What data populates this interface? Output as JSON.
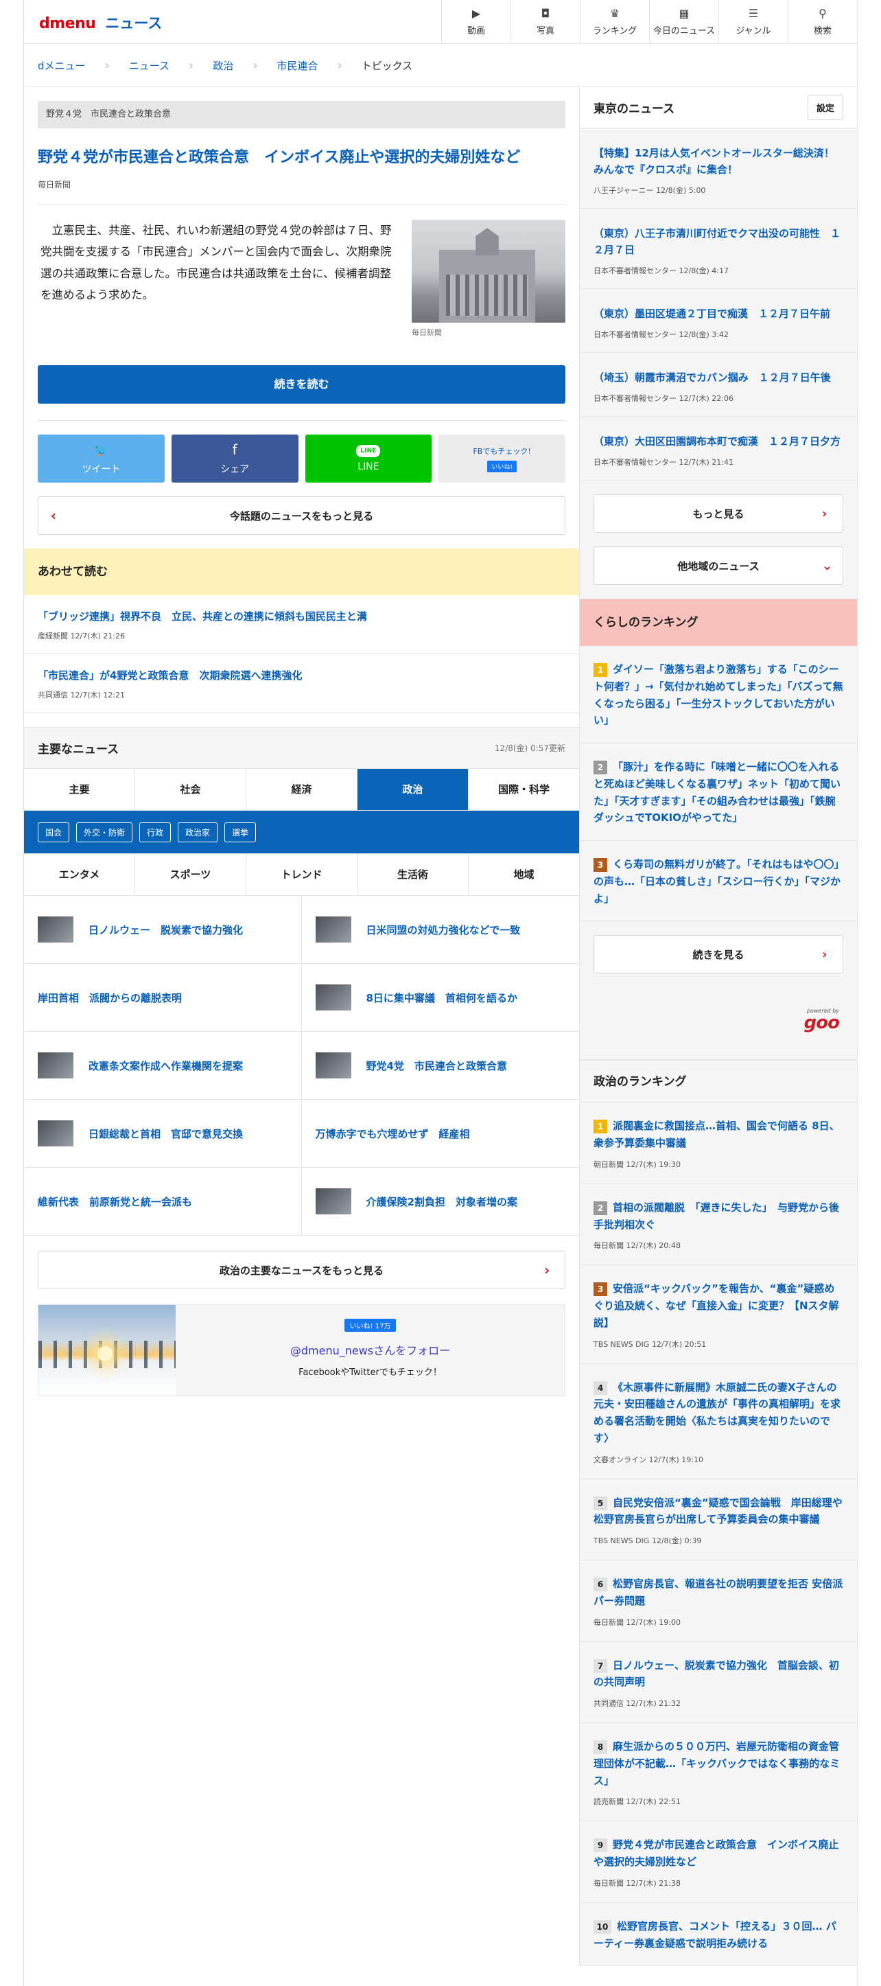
{
  "header": {
    "logo_d": "dmenu",
    "logo_news": "ニュース",
    "nav": [
      {
        "label": "動画",
        "icon": "video-icon"
      },
      {
        "label": "写真",
        "icon": "camera-icon"
      },
      {
        "label": "ランキング",
        "icon": "crown-icon"
      },
      {
        "label": "今日のニュース",
        "icon": "calendar-icon"
      },
      {
        "label": "ジャンル",
        "icon": "list-icon"
      },
      {
        "label": "検索",
        "icon": "search-icon"
      }
    ]
  },
  "breadcrumb": [
    "dメニュー",
    "ニュース",
    "政治",
    "市民連合",
    "トピックス"
  ],
  "article": {
    "topic": "野党４党　市民連合と政策合意",
    "title": "野党４党が市民連合と政策合意　インボイス廃止や選択的夫婦別姓など",
    "source": "毎日新聞",
    "body": "立憲民主、共産、社民、れいわ新選組の野党４党の幹部は７日、野党共闘を支援する「市民連合」メンバーと国会内で面会し、次期衆院選の共通政策に合意した。市民連合は共通政策を土台に、候補者調整を進めるよう求めた。",
    "photo_caption": "毎日新聞",
    "read_more": "続きを読む",
    "share": {
      "tweet": "ツイート",
      "share": "シェア",
      "line": "LINE",
      "line_logo": "LINE",
      "fb_check": "FBでもチェック!",
      "fb_like": "いいね!"
    },
    "more_topic": "今話題のニュースをもっと見る"
  },
  "related": {
    "heading": "あわせて読む",
    "items": [
      {
        "title": "「ブリッジ連携」視界不良　立民、共産との連携に傾斜も国民民主と溝",
        "source": "産経新聞",
        "time": "12/7(木) 21:26"
      },
      {
        "title": "「市民連合」が4野党と政策合意　次期衆院選へ連携強化",
        "source": "共同通信",
        "time": "12/7(木) 12:21"
      }
    ]
  },
  "main_news": {
    "heading": "主要なニュース",
    "updated": "12/8(金) 0:57更新",
    "tabs_row1": [
      "主要",
      "社会",
      "経済",
      "政治",
      "国際・科学"
    ],
    "active_tab": "政治",
    "subtabs": [
      "国会",
      "外交・防衛",
      "行政",
      "政治家",
      "選挙"
    ],
    "tabs_row2": [
      "エンタメ",
      "スポーツ",
      "トレンド",
      "生活術",
      "地域"
    ],
    "items": [
      {
        "title": "日ノルウェー　脱炭素で協力強化",
        "has_thumb": true
      },
      {
        "title": "日米同盟の対処力強化などで一致",
        "has_thumb": true
      },
      {
        "title": "岸田首相　派閥からの離脱表明",
        "has_thumb": false
      },
      {
        "title": "8日に集中審議　首相何を語るか",
        "has_thumb": true
      },
      {
        "title": "改憲条文案作成へ作業機関を提案",
        "has_thumb": true
      },
      {
        "title": "野党4党　市民連合と政策合意",
        "has_thumb": true
      },
      {
        "title": "日銀総裁と首相　官邸で意見交換",
        "has_thumb": true
      },
      {
        "title": "万博赤字でも穴埋めせず　経産相",
        "has_thumb": false
      },
      {
        "title": "維新代表　前原新党と統一会派も",
        "has_thumb": false
      },
      {
        "title": "介護保険2割負担　対象者増の案",
        "has_thumb": true
      }
    ],
    "more": "政治の主要なニュースをもっと見る",
    "follow": {
      "like": "いいね! 17万",
      "handle": "@dmenu_newsさんをフォロー",
      "sub": "FacebookやTwitterでもチェック！"
    }
  },
  "side": {
    "tokyo": {
      "heading": "東京のニュース",
      "setting": "設定",
      "items": [
        {
          "title": "【特集】12月は人気イベントオールスター総決済！みんなで『クロスポ』に集合！",
          "source": "八王子ジャーニー",
          "time": "12/8(金) 5:00"
        },
        {
          "title": "（東京）八王子市清川町付近でクマ出没の可能性　１２月７日",
          "source": "日本不審者情報センター",
          "time": "12/8(金) 4:17"
        },
        {
          "title": "（東京）墨田区堤通２丁目で痴漢　１２月７日午前",
          "source": "日本不審者情報センター",
          "time": "12/8(金) 3:42"
        },
        {
          "title": "（埼玉）朝霞市溝沼でカバン掴み　１２月７日午後",
          "source": "日本不審者情報センター",
          "time": "12/7(木) 22:06"
        },
        {
          "title": "（東京）大田区田園調布本町で痴漢　１２月７日夕方",
          "source": "日本不審者情報センター",
          "time": "12/7(木) 21:41"
        }
      ],
      "more": "もっと見る",
      "other": "他地域のニュース"
    },
    "kurashi": {
      "heading": "くらしのランキング",
      "items": [
        {
          "rank": "1",
          "title": "ダイソー「激落ち君より激落ち」する「このシート何者？」→「気付かれ始めてしまった」「バズって無くなったら困る」「一生分ストックしておいた方がいい」"
        },
        {
          "rank": "2",
          "title": "「豚汁」を作る時に「味噌と一緒に〇〇を入れると死ぬほど美味しくなる裏ワザ」ネット「初めて聞いた」「天才すぎます」「その組み合わせは最強」「鉄腕ダッシュでTOKIOがやってた」"
        },
        {
          "rank": "3",
          "title": "くら寿司の無料ガリが終了。「それはもはや〇〇」の声も…「日本の貧しさ」「スシロー行くか」「マジかよ」"
        }
      ],
      "more": "続きを見る",
      "powered": "powered by",
      "goo": "goo"
    },
    "politics": {
      "heading": "政治のランキング",
      "items": [
        {
          "rank": "1",
          "title": "派閥裏金に救国接点…首相、国会で何語る 8日、衆参予算委集中審議",
          "source": "朝日新聞",
          "time": "12/7(木) 19:30"
        },
        {
          "rank": "2",
          "title": "首相の派閥離脱　「遅きに失した」　与野党から後手批判相次ぐ",
          "source": "毎日新聞",
          "time": "12/7(木) 20:48"
        },
        {
          "rank": "3",
          "title": "安倍派“キックバック”を報告か、“裏金”疑惑めぐり追及続く、なぜ「直接入金」に変更？【Nスタ解説】",
          "source": "TBS NEWS DIG",
          "time": "12/7(木) 20:51"
        },
        {
          "rank": "4",
          "title": "《木原事件に新展開》木原誠二氏の妻X子さんの元夫・安田種雄さんの遺族が「事件の真相解明」を求める署名活動を開始〈私たちは真実を知りたいのです〉",
          "source": "文春オンライン",
          "time": "12/7(木) 19:10"
        },
        {
          "rank": "5",
          "title": "自民党安倍派“裏金”疑惑で国会論戦　岸田総理や松野官房長官らが出席して予算委員会の集中審議",
          "source": "TBS NEWS DIG",
          "time": "12/8(金) 0:39"
        },
        {
          "rank": "6",
          "title": "松野官房長官、報道各社の説明要望を拒否 安倍派パー券問題",
          "source": "毎日新聞",
          "time": "12/7(木) 19:00"
        },
        {
          "rank": "7",
          "title": "日ノルウェー、脱炭素で協力強化　首脳会談、初の共同声明",
          "source": "共同通信",
          "time": "12/7(木) 21:32"
        },
        {
          "rank": "8",
          "title": "麻生派からの５００万円、岩屋元防衛相の資金管理団体が不記載…「キックバックではなく事務的なミス」",
          "source": "読売新聞",
          "time": "12/7(木) 22:51"
        },
        {
          "rank": "9",
          "title": "野党４党が市民連合と政策合意　インボイス廃止や選択的夫婦別姓など",
          "source": "毎日新聞",
          "time": "12/7(木) 21:38"
        },
        {
          "rank": "10",
          "title": "松野官房長官、コメント「控える」３０回… パーティー券裏金疑惑で説明拒み続ける",
          "source": "",
          "time": ""
        }
      ]
    }
  }
}
